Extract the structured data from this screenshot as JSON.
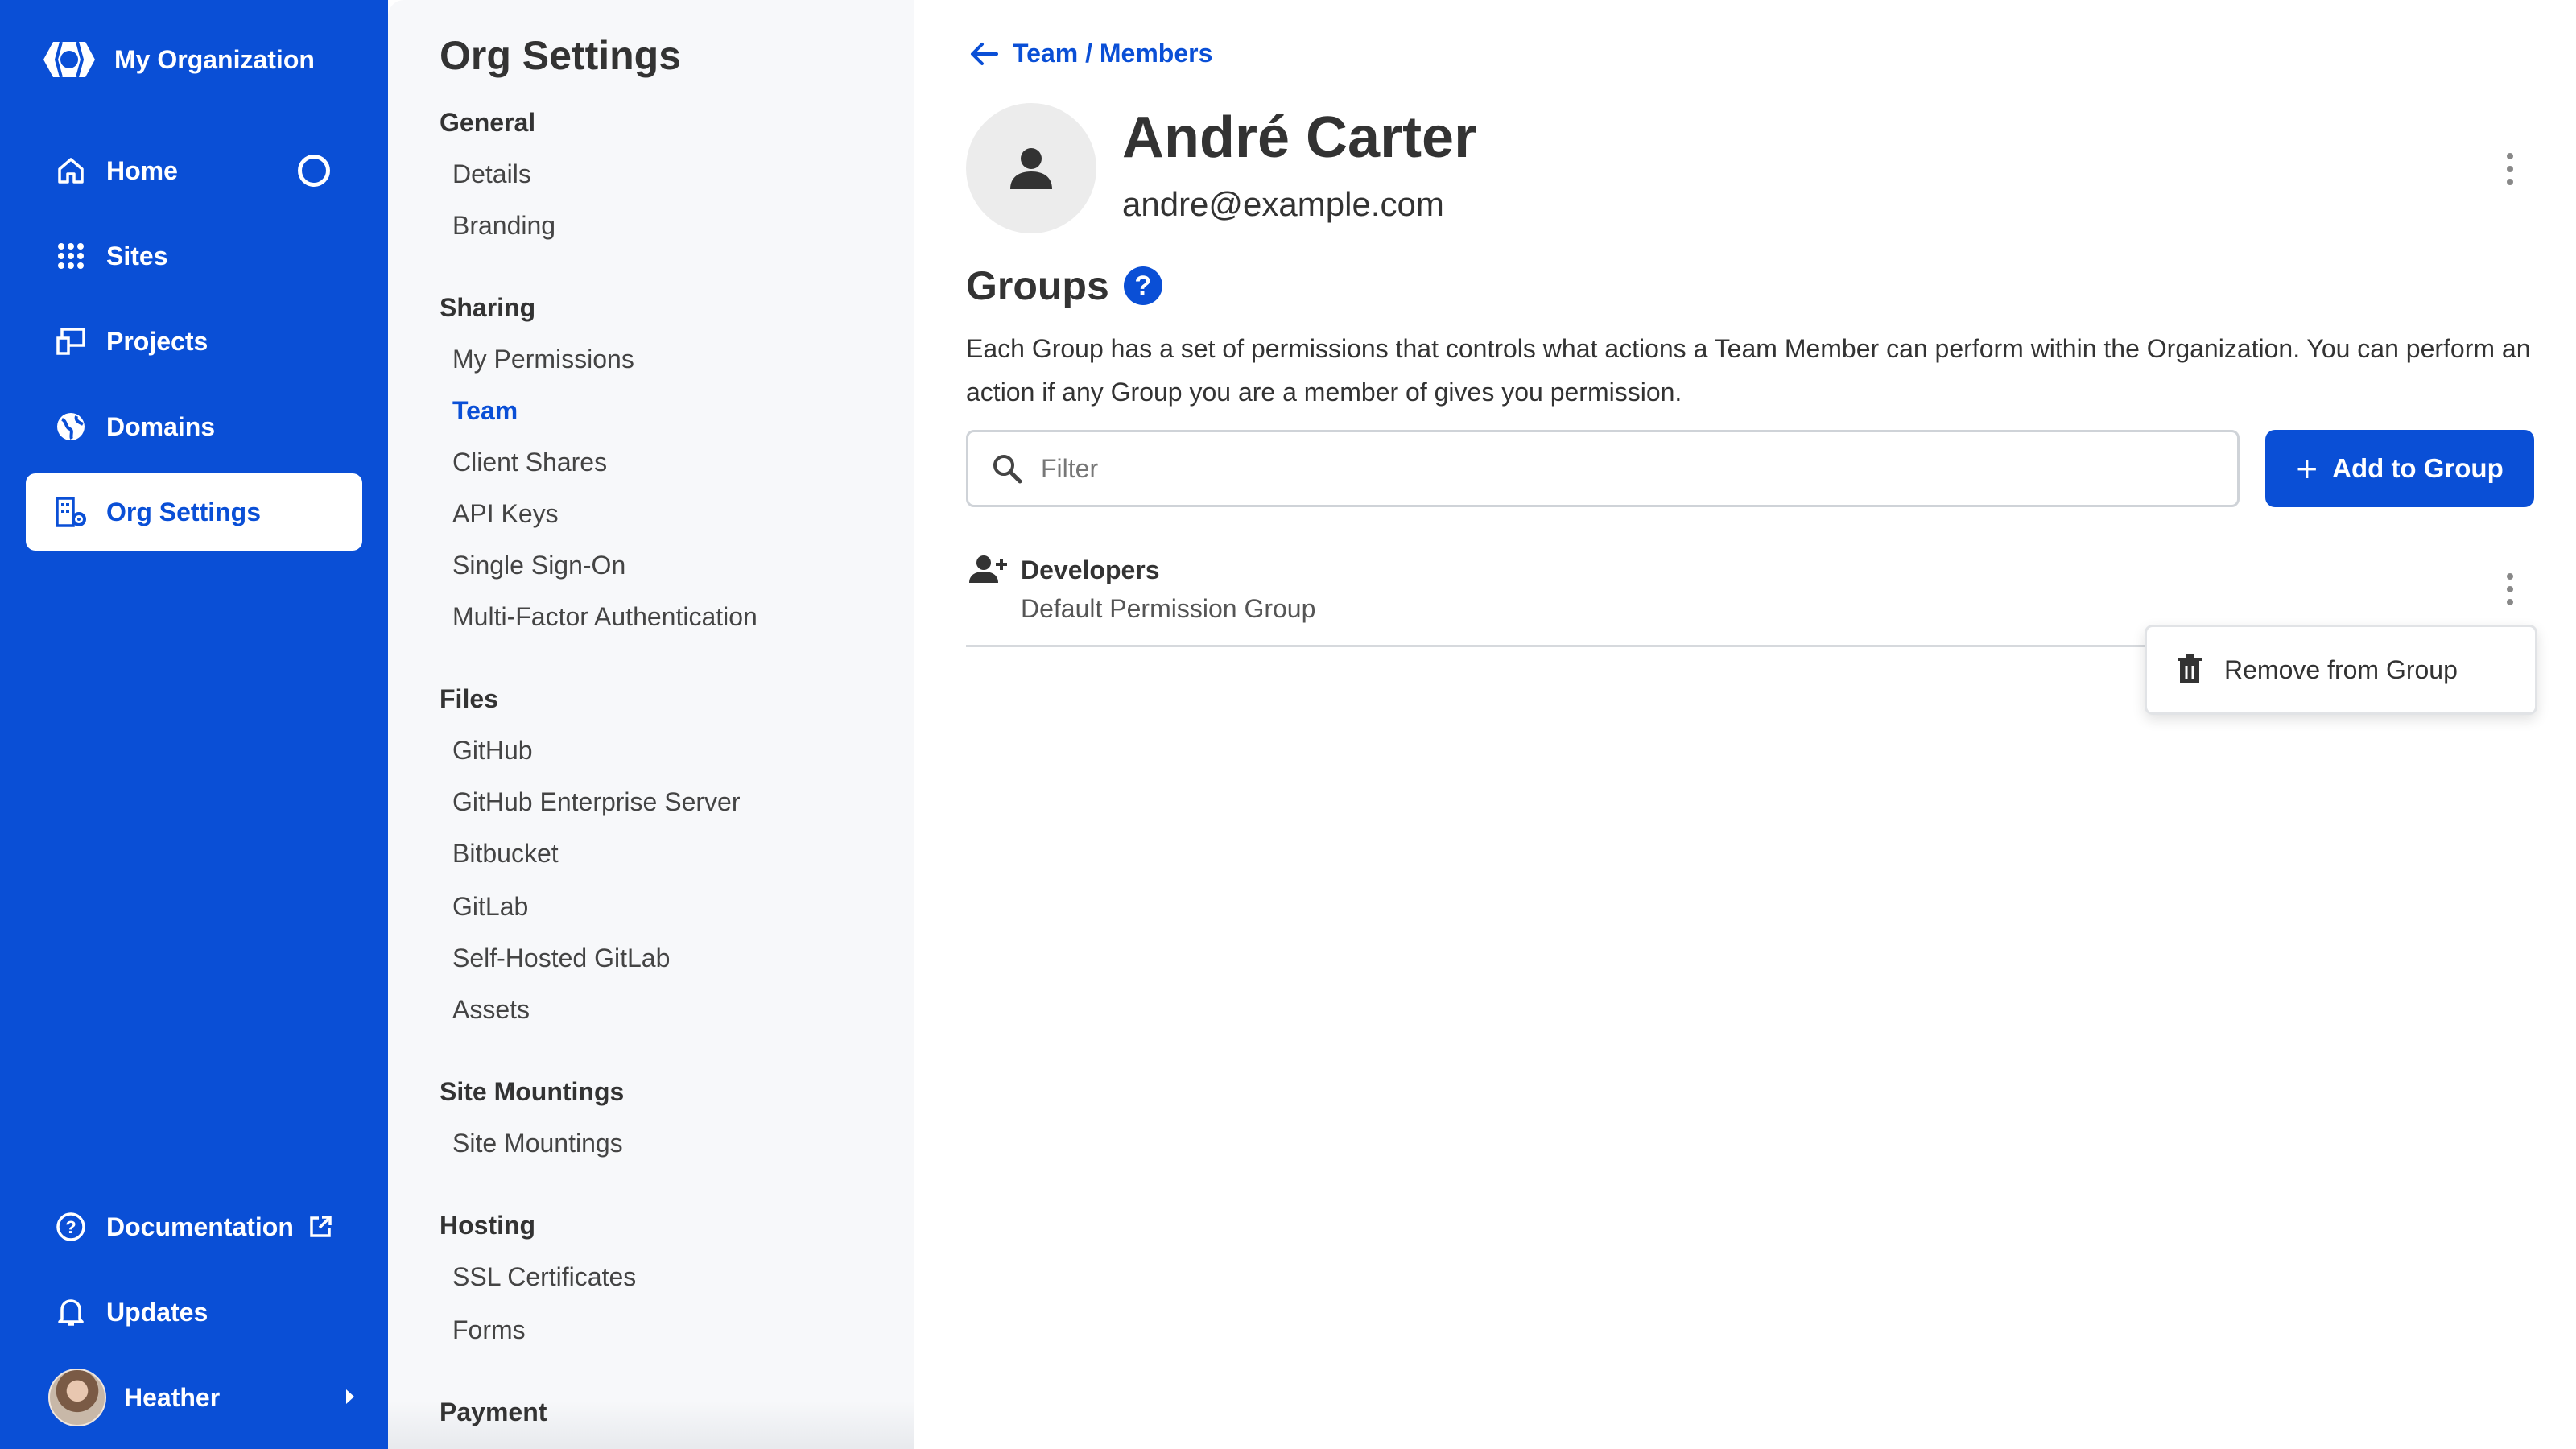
{
  "org": {
    "name": "My Organization",
    "logo_icon": "org-logo-icon"
  },
  "nav": {
    "items": [
      {
        "label": "Home",
        "icon": "home-icon"
      },
      {
        "label": "Sites",
        "icon": "grid-icon"
      },
      {
        "label": "Projects",
        "icon": "projects-icon"
      },
      {
        "label": "Domains",
        "icon": "globe-icon"
      },
      {
        "label": "Org Settings",
        "icon": "org-settings-icon",
        "active": true
      }
    ],
    "bottom": [
      {
        "label": "Documentation",
        "icon": "help-circle-icon"
      },
      {
        "label": "Updates",
        "icon": "bell-icon"
      }
    ],
    "user": {
      "name": "Heather"
    }
  },
  "settings": {
    "title": "Org Settings",
    "sections": [
      {
        "heading": "General",
        "items": [
          "Details",
          "Branding"
        ]
      },
      {
        "heading": "Sharing",
        "items": [
          "My Permissions",
          "Team",
          "Client Shares",
          "API Keys",
          "Single Sign-On",
          "Multi-Factor Authentication"
        ]
      },
      {
        "heading": "Files",
        "items": [
          "GitHub",
          "GitHub Enterprise Server",
          "Bitbucket",
          "GitLab",
          "Self-Hosted GitLab",
          "Assets"
        ]
      },
      {
        "heading": "Site Mountings",
        "items": [
          "Site Mountings"
        ]
      },
      {
        "heading": "Hosting",
        "items": [
          "SSL Certificates",
          "Forms"
        ]
      },
      {
        "heading": "Payment",
        "items": []
      }
    ],
    "active_item": "Team"
  },
  "main": {
    "breadcrumb": "Team / Members",
    "member": {
      "name": "André Carter",
      "email": "andre@example.com"
    },
    "groups": {
      "heading": "Groups",
      "help_glyph": "?",
      "description": "Each Group has a set of permissions that controls what actions a Team Member can perform within the Organization. You can perform an action if any Group you are a member of gives you permission.",
      "filter_placeholder": "Filter",
      "add_button_label": "Add to Group",
      "rows": [
        {
          "name": "Developers",
          "subtitle": "Default Permission Group"
        }
      ]
    },
    "context_menu": {
      "item_label": "Remove from Group",
      "item_icon": "trash-icon"
    }
  },
  "colors": {
    "brand_blue": "#0a4fd6",
    "text": "#333333",
    "settings_bg": "#f7f8fa"
  }
}
